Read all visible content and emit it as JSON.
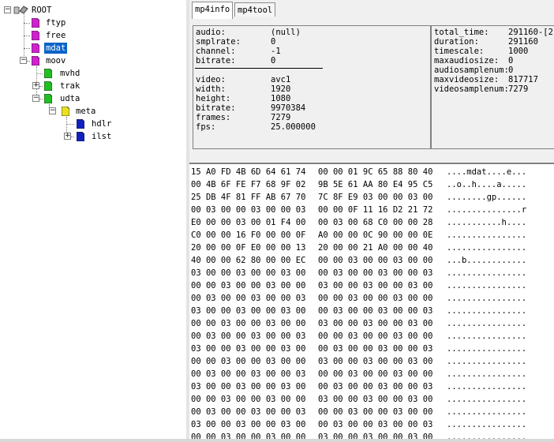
{
  "tree": {
    "root": {
      "label": "ROOT",
      "icon": "tree-root-icon"
    },
    "nodes": [
      {
        "label": "ftyp",
        "color": "#d020d0"
      },
      {
        "label": "free",
        "color": "#d020d0"
      },
      {
        "label": "mdat",
        "color": "#d020d0",
        "selected": true
      },
      {
        "label": "moov",
        "color": "#d020d0"
      },
      {
        "label": "mvhd",
        "color": "#20c020"
      },
      {
        "label": "trak",
        "color": "#20c020"
      },
      {
        "label": "udta",
        "color": "#20c020"
      },
      {
        "label": "meta",
        "color": "#e8e020"
      },
      {
        "label": "hdlr",
        "color": "#1020c0"
      },
      {
        "label": "ilst",
        "color": "#1020c0"
      }
    ]
  },
  "tabs": [
    {
      "label": "mp4info",
      "active": true
    },
    {
      "label": "mp4tool",
      "active": false
    }
  ],
  "info_left": {
    "audio": [
      {
        "k": "audio:",
        "v": "(null)"
      },
      {
        "k": "smplrate:",
        "v": "0"
      },
      {
        "k": "channel:",
        "v": "-1"
      },
      {
        "k": "bitrate:",
        "v": "0"
      }
    ],
    "video": [
      {
        "k": "video:",
        "v": "avc1"
      },
      {
        "k": "width:",
        "v": "1920"
      },
      {
        "k": "height:",
        "v": "1080"
      },
      {
        "k": "bitrate:",
        "v": "9970384"
      },
      {
        "k": "frames:",
        "v": "7279"
      },
      {
        "k": "fps:",
        "v": "25.000000"
      }
    ]
  },
  "info_right": [
    {
      "k": "total_time:",
      "v": "291160-[2"
    },
    {
      "k": "duration:",
      "v": "291160"
    },
    {
      "k": "timescale:",
      "v": "1000"
    },
    {
      "k": "maxaudiosize:",
      "v": "0"
    },
    {
      "k": "audiosamplenum:",
      "v": "0"
    },
    {
      "k": "maxvideosize:",
      "v": "817717"
    },
    {
      "k": "videosamplenum:",
      "v": "7279"
    }
  ],
  "hex_rows": [
    {
      "a": "15 A0 FD 4B 6D 64 61 74",
      "b": "00 00 01 9C 65 88 80 40",
      "t": "....mdat....e..."
    },
    {
      "a": "00 4B 6F FE F7 68 9F 02",
      "b": "9B 5E 61 AA 80 E4 95 C5",
      "t": "..o..h....a....."
    },
    {
      "a": "25 DB 4F 81 FF AB 67 70",
      "b": "7C 8F E9 03 00 00 03 00",
      "t": "........gp......"
    },
    {
      "a": "00 03 00 00 03 00 00 03",
      "b": "00 00 0F 11 16 D2 21 72",
      "t": "...............r"
    },
    {
      "a": "E0 00 00 03 00 01 F4 00",
      "b": "00 03 00 68 C0 00 00 28",
      "t": "...........h...."
    },
    {
      "a": "C0 00 00 16 F0 00 00 0F",
      "b": "A0 00 00 0C 90 00 00 0E",
      "t": "................"
    },
    {
      "a": "20 00 00 0F E0 00 00 13",
      "b": "20 00 00 21 A0 00 00 40",
      "t": "................"
    },
    {
      "a": "40 00 00 62 80 00 00 EC",
      "b": "00 00 03 00 00 03 00 00",
      "t": "...b............"
    },
    {
      "a": "03 00 00 03 00 00 03 00",
      "b": "00 03 00 00 03 00 00 03",
      "t": "................"
    },
    {
      "a": "00 00 03 00 00 03 00 00",
      "b": "03 00 00 03 00 00 03 00",
      "t": "................"
    },
    {
      "a": "00 03 00 00 03 00 00 03",
      "b": "00 00 03 00 00 03 00 00",
      "t": "................"
    },
    {
      "a": "03 00 00 03 00 00 03 00",
      "b": "00 03 00 00 03 00 00 03",
      "t": "................"
    },
    {
      "a": "00 00 03 00 00 03 00 00",
      "b": "03 00 00 03 00 00 03 00",
      "t": "................"
    },
    {
      "a": "00 03 00 00 03 00 00 03",
      "b": "00 00 03 00 00 03 00 00",
      "t": "................"
    },
    {
      "a": "03 00 00 03 00 00 03 00",
      "b": "00 03 00 00 03 00 00 03",
      "t": "................"
    },
    {
      "a": "00 00 03 00 00 03 00 00",
      "b": "03 00 00 03 00 00 03 00",
      "t": "................"
    },
    {
      "a": "00 03 00 00 03 00 00 03",
      "b": "00 00 03 00 00 03 00 00",
      "t": "................"
    },
    {
      "a": "03 00 00 03 00 00 03 00",
      "b": "00 03 00 00 03 00 00 03",
      "t": "................"
    },
    {
      "a": "00 00 03 00 00 03 00 00",
      "b": "03 00 00 03 00 00 03 00",
      "t": "................"
    },
    {
      "a": "00 03 00 00 03 00 00 03",
      "b": "00 00 03 00 00 03 00 00",
      "t": "................"
    },
    {
      "a": "03 00 00 03 00 00 03 00",
      "b": "00 03 00 00 03 00 00 03",
      "t": "................"
    },
    {
      "a": "00 00 03 00 00 03 00 00",
      "b": "03 00 00 03 00 00 03 00",
      "t": "................"
    }
  ]
}
